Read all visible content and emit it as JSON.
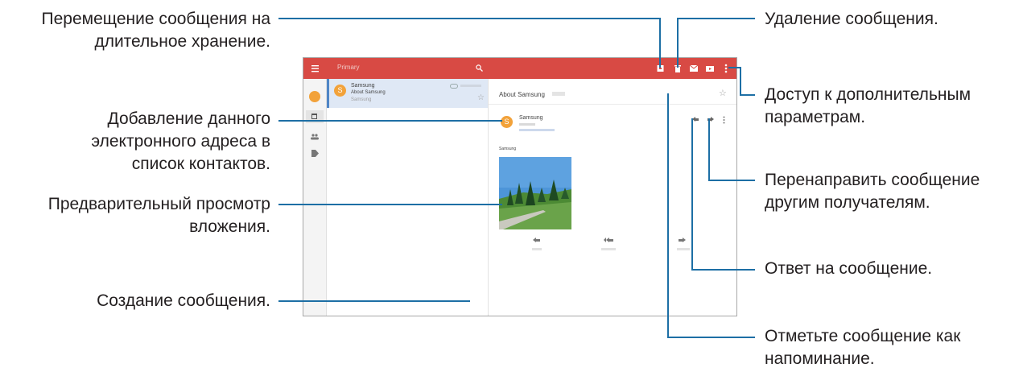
{
  "labels": {
    "archive": [
      "Перемещение сообщения на",
      "длительное хранение."
    ],
    "add_contact": [
      "Добавление данного",
      "электронного адреса в",
      "список контактов."
    ],
    "preview": [
      "Предварительный просмотр",
      "вложения."
    ],
    "compose": "Создание сообщения.",
    "delete": "Удаление сообщения.",
    "more_options": [
      "Доступ к дополнительным",
      "параметрам."
    ],
    "forward": [
      "Перенаправить сообщение",
      "другим получателям."
    ],
    "reply": "Ответ на сообщение.",
    "reminder": [
      "Отметьте сообщение как",
      "напоминание."
    ]
  },
  "screen": {
    "app_title": "Primary",
    "list_item": {
      "avatar_letter": "S",
      "sender": "Samsung",
      "subject": "About Samsung",
      "preview": "Samsung"
    },
    "reader": {
      "subject": "About Samsung",
      "avatar_letter": "S",
      "sender": "Samsung",
      "body": "Samsung"
    }
  },
  "colors": {
    "appbar": "#d84a44",
    "avatar": "#f2a23a",
    "callout_line": "#1d6fa5",
    "fab": "#d33b36"
  }
}
